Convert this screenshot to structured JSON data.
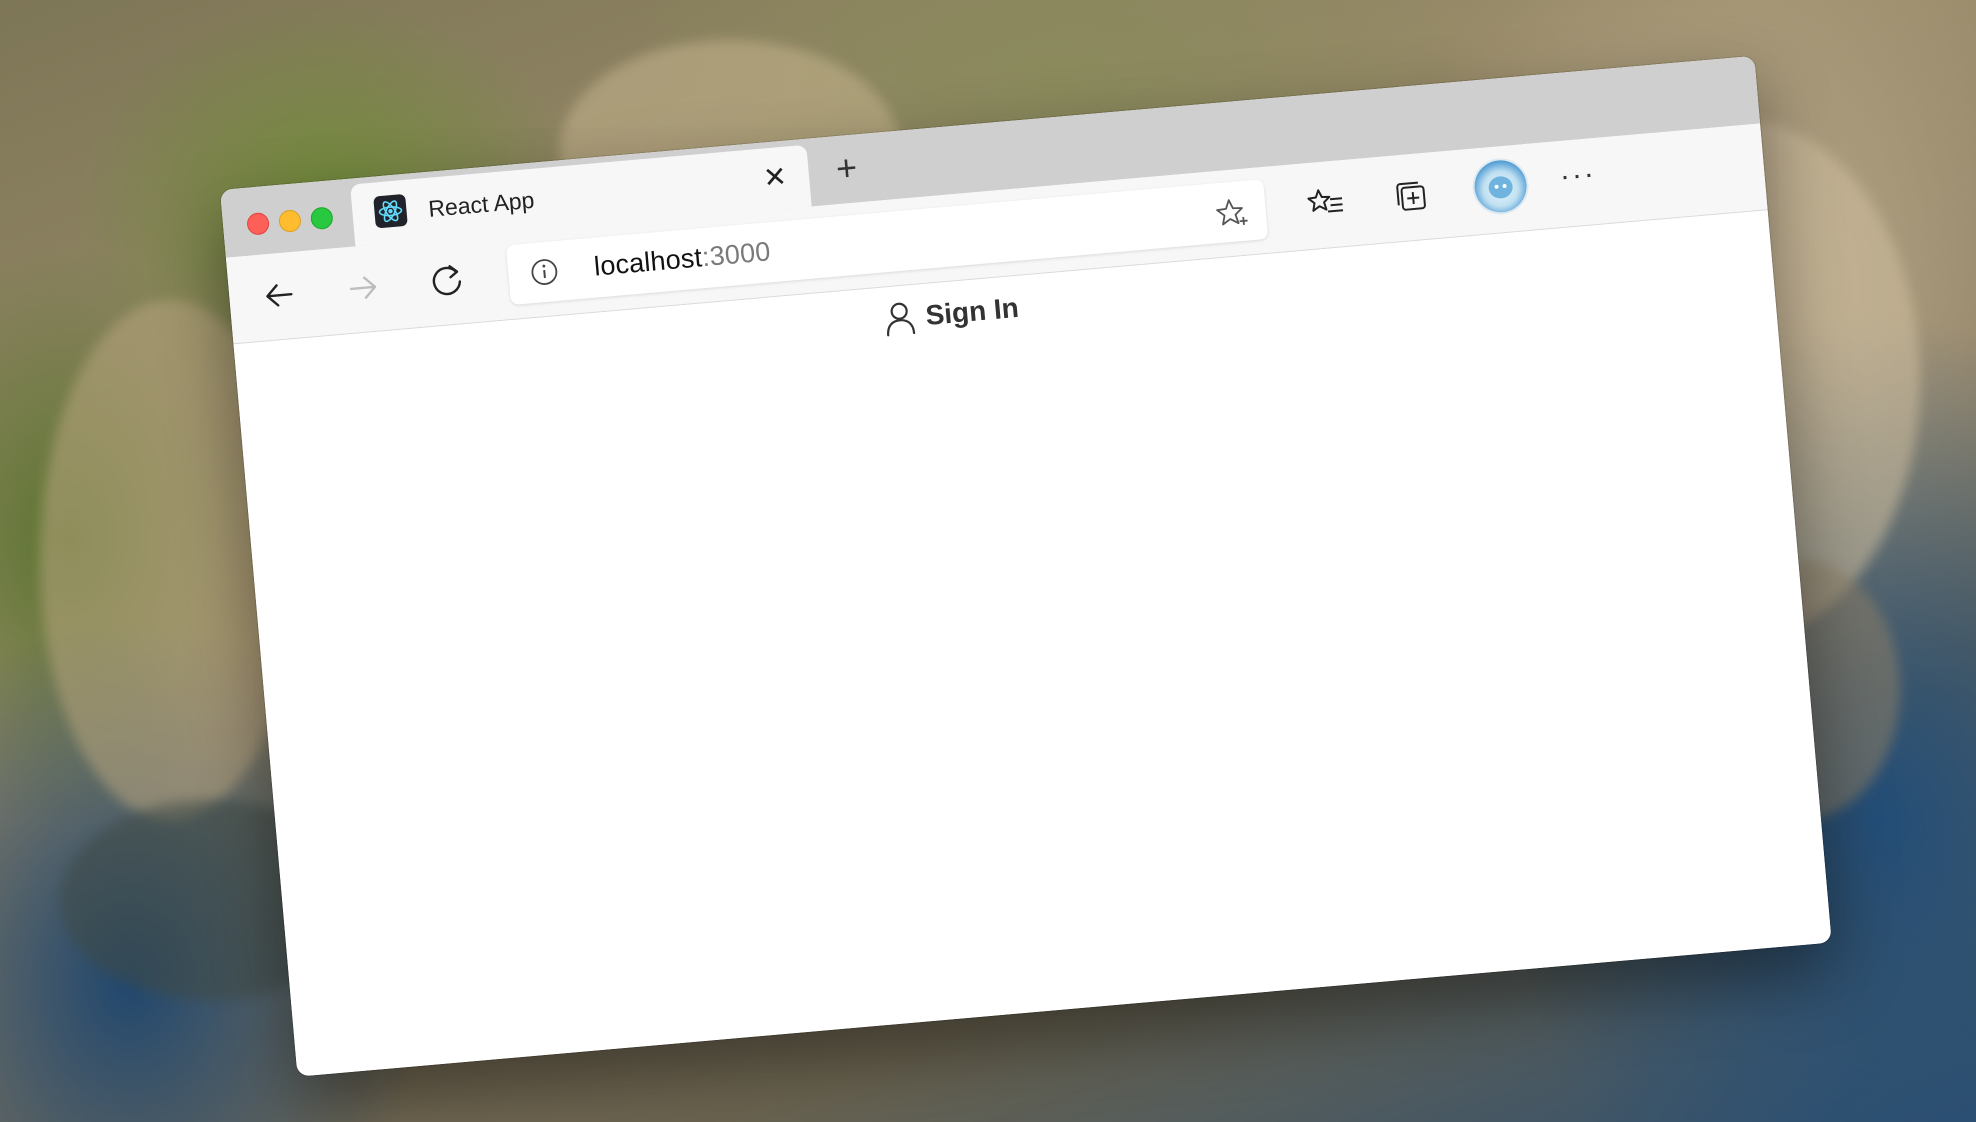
{
  "browser": {
    "tab": {
      "title": "React App",
      "favicon": "react-logo-icon",
      "close_icon": "close-icon"
    },
    "new_tab_icon": "plus-icon",
    "toolbar": {
      "back_icon": "back-arrow-icon",
      "forward_icon": "forward-arrow-icon",
      "reload_icon": "reload-icon",
      "address": {
        "info_icon": "info-icon",
        "host": "localhost",
        "port": ":3000",
        "favorite_icon": "star-add-icon"
      },
      "favorites_icon": "favorites-list-icon",
      "collections_icon": "collections-icon",
      "profile_icon": "profile-avatar-icon",
      "more_label": "···"
    }
  },
  "page": {
    "sign_in_label": "Sign In",
    "user_icon": "user-icon"
  },
  "colors": {
    "tabstrip": "#cfcfcf",
    "toolbar": "#f7f7f7",
    "close_red": "#fe5f57",
    "minimize_yellow": "#febc2e",
    "zoom_green": "#28c840",
    "react_cyan": "#61dafb"
  }
}
